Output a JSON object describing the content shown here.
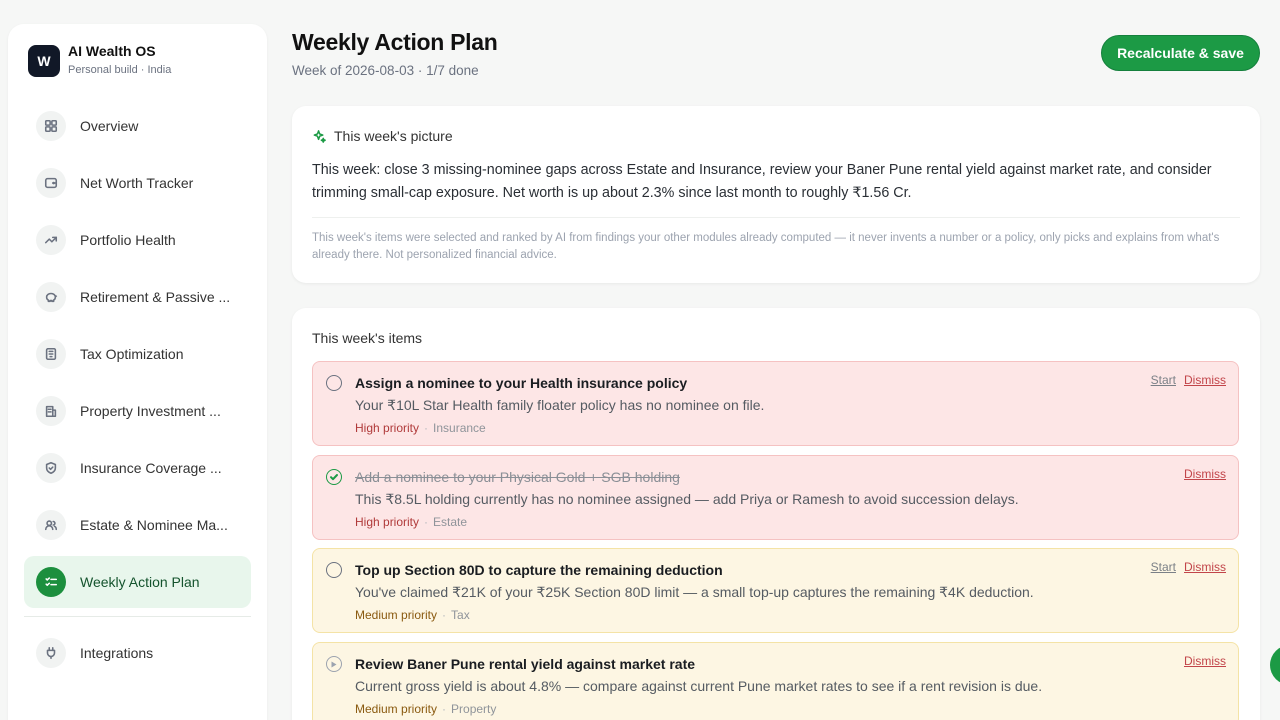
{
  "brand": {
    "logo_letter": "W",
    "name": "AI Wealth OS",
    "subtitle": "Personal build · India"
  },
  "nav": {
    "items": [
      {
        "label": "Overview",
        "icon": "grid-icon",
        "active": false
      },
      {
        "label": "Net Worth Tracker",
        "icon": "wallet-icon",
        "active": false
      },
      {
        "label": "Portfolio Health",
        "icon": "trending-up-icon",
        "active": false
      },
      {
        "label": "Retirement & Passive ...",
        "icon": "piggy-bank-icon",
        "active": false
      },
      {
        "label": "Tax Optimization",
        "icon": "receipt-icon",
        "active": false
      },
      {
        "label": "Property Investment ...",
        "icon": "building-icon",
        "active": false
      },
      {
        "label": "Insurance Coverage ...",
        "icon": "shield-icon",
        "active": false
      },
      {
        "label": "Estate & Nominee Ma...",
        "icon": "users-icon",
        "active": false
      },
      {
        "label": "Weekly Action Plan",
        "icon": "checklist-icon",
        "active": true
      }
    ],
    "integrations_label": "Integrations",
    "integrations_icon": "plug-icon"
  },
  "header": {
    "title": "Weekly Action Plan",
    "subtitle": "Week of 2026-08-03 · 1/7 done",
    "primary_button": "Recalculate & save"
  },
  "picture": {
    "title": "This week's picture",
    "icon": "sparkles-icon",
    "body": "This week: close 3 missing-nominee gaps across Estate and Insurance, review your Baner Pune rental yield against market rate, and consider trimming small-cap exposure. Net worth is up about 2.3% since last month to roughly ₹1.56 Cr.",
    "note": "This week's items were selected and ranked by AI from findings your other modules already computed — it never invents a number or a policy, only picks and explains from what's already there. Not personalized financial advice."
  },
  "items_section": {
    "title": "This week's items",
    "start_label": "Start",
    "dismiss_label": "Dismiss",
    "sep": "·",
    "items": [
      {
        "title": "Assign a nominee to your Health insurance policy",
        "desc": "Your ₹10L Star Health family floater policy has no nominee on file.",
        "priority": "High priority",
        "category": "Insurance",
        "status": "open"
      },
      {
        "title": "Add a nominee to your Physical Gold + SGB holding",
        "desc": "This ₹8.5L holding currently has no nominee assigned — add Priya or Ramesh to avoid succession delays.",
        "priority": "High priority",
        "category": "Estate",
        "status": "done"
      },
      {
        "title": "Top up Section 80D to capture the remaining deduction",
        "desc": "You've claimed ₹21K of your ₹25K Section 80D limit — a small top-up captures the remaining ₹4K deduction.",
        "priority": "Medium priority",
        "category": "Tax",
        "status": "open"
      },
      {
        "title": "Review Baner Pune rental yield against market rate",
        "desc": "Current gross yield is about 4.8% — compare against current Pune market rates to see if a rent revision is due.",
        "priority": "Medium priority",
        "category": "Property",
        "status": "in-progress"
      }
    ]
  },
  "colors": {
    "accent": "#1c9a45",
    "high_bg": "#fde6e6",
    "medium_bg": "#fdf6e3",
    "dismiss": "#c2454a"
  }
}
